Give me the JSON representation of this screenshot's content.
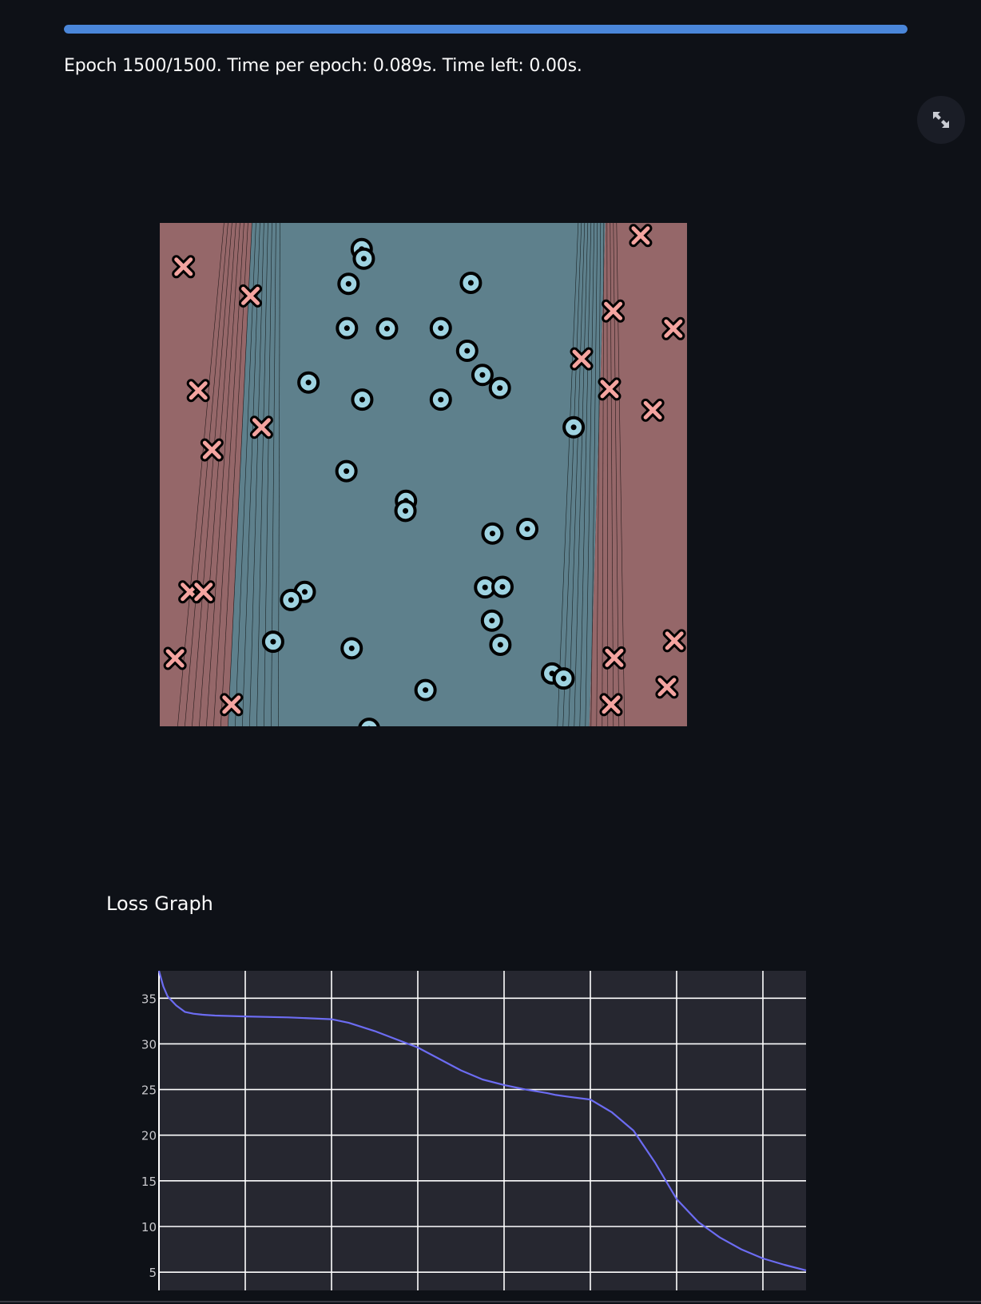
{
  "progress": {
    "fraction": 1.0,
    "text": "Epoch 1500/1500. Time per epoch: 0.089s. Time left: 0.00s."
  },
  "fullscreen": {
    "icon": "expand-arrows-icon"
  },
  "colors": {
    "background": "#0e1117",
    "progress": "#4a86d9",
    "region_class_x": "#956769",
    "region_class_o": "#5e808c",
    "marker_x": "#f4a4a0",
    "marker_o": "#9fd3e1",
    "loss_line": "#6c6cf2",
    "chart_bg": "#262730"
  },
  "loss_section": {
    "title": "Loss Graph"
  },
  "chart_data": [
    {
      "type": "scatter",
      "title": "",
      "xlabel": "",
      "ylabel": "",
      "xlim": [
        0,
        1
      ],
      "ylim": [
        0,
        1
      ],
      "grid": false,
      "legend": "none",
      "decision_regions": [
        {
          "class": "x",
          "x_range": [
            0,
            0.19
          ]
        },
        {
          "class": "o",
          "x_range": [
            0.19,
            0.83
          ]
        },
        {
          "class": "x",
          "x_range": [
            0.83,
            1.0
          ]
        }
      ],
      "series": [
        {
          "marker": "x",
          "points": [
            [
              0.045,
              0.913
            ],
            [
              0.172,
              0.855
            ],
            [
              0.073,
              0.667
            ],
            [
              0.099,
              0.549
            ],
            [
              0.193,
              0.594
            ],
            [
              0.057,
              0.267
            ],
            [
              0.083,
              0.267
            ],
            [
              0.029,
              0.135
            ],
            [
              0.136,
              0.043
            ],
            [
              0.912,
              0.975
            ],
            [
              0.86,
              0.825
            ],
            [
              0.8,
              0.73
            ],
            [
              0.974,
              0.79
            ],
            [
              0.853,
              0.67
            ],
            [
              0.935,
              0.628
            ],
            [
              0.862,
              0.136
            ],
            [
              0.976,
              0.17
            ],
            [
              0.962,
              0.078
            ],
            [
              0.856,
              0.043
            ]
          ]
        },
        {
          "marker": "o",
          "points": [
            [
              0.383,
              0.948
            ],
            [
              0.387,
              0.929
            ],
            [
              0.358,
              0.879
            ],
            [
              0.59,
              0.881
            ],
            [
              0.355,
              0.791
            ],
            [
              0.431,
              0.79
            ],
            [
              0.533,
              0.791
            ],
            [
              0.583,
              0.746
            ],
            [
              0.282,
              0.683
            ],
            [
              0.384,
              0.649
            ],
            [
              0.533,
              0.649
            ],
            [
              0.612,
              0.698
            ],
            [
              0.645,
              0.672
            ],
            [
              0.785,
              0.594
            ],
            [
              0.354,
              0.507
            ],
            [
              0.467,
              0.448
            ],
            [
              0.466,
              0.428
            ],
            [
              0.631,
              0.383
            ],
            [
              0.697,
              0.392
            ],
            [
              0.275,
              0.267
            ],
            [
              0.249,
              0.251
            ],
            [
              0.617,
              0.276
            ],
            [
              0.65,
              0.277
            ],
            [
              0.63,
              0.21
            ],
            [
              0.646,
              0.162
            ],
            [
              0.364,
              0.155
            ],
            [
              0.215,
              0.168
            ],
            [
              0.504,
              0.072
            ],
            [
              0.744,
              0.105
            ],
            [
              0.766,
              0.095
            ],
            [
              0.397,
              -0.005
            ]
          ]
        }
      ]
    },
    {
      "type": "line",
      "title": "Loss Graph",
      "xlabel": "",
      "ylabel": "",
      "ylim": [
        3,
        38
      ],
      "xlim": [
        0,
        1500
      ],
      "grid": true,
      "y_ticks": [
        "5",
        "10",
        "15",
        "20",
        "25",
        "30",
        "35"
      ],
      "x": [
        0,
        10,
        20,
        40,
        60,
        80,
        100,
        130,
        200,
        300,
        400,
        440,
        500,
        600,
        700,
        750,
        800,
        850,
        900,
        920,
        950,
        1000,
        1050,
        1100,
        1150,
        1200,
        1250,
        1300,
        1350,
        1400,
        1450,
        1500
      ],
      "series": [
        {
          "values": [
            38.0,
            36.3,
            35.2,
            34.2,
            33.5,
            33.3,
            33.2,
            33.1,
            33.0,
            32.9,
            32.7,
            32.3,
            31.4,
            29.6,
            27.1,
            26.1,
            25.5,
            25.0,
            24.6,
            24.4,
            24.2,
            23.9,
            22.5,
            20.5,
            17.0,
            13.0,
            10.5,
            8.8,
            7.5,
            6.5,
            5.8,
            5.2
          ]
        }
      ]
    }
  ]
}
